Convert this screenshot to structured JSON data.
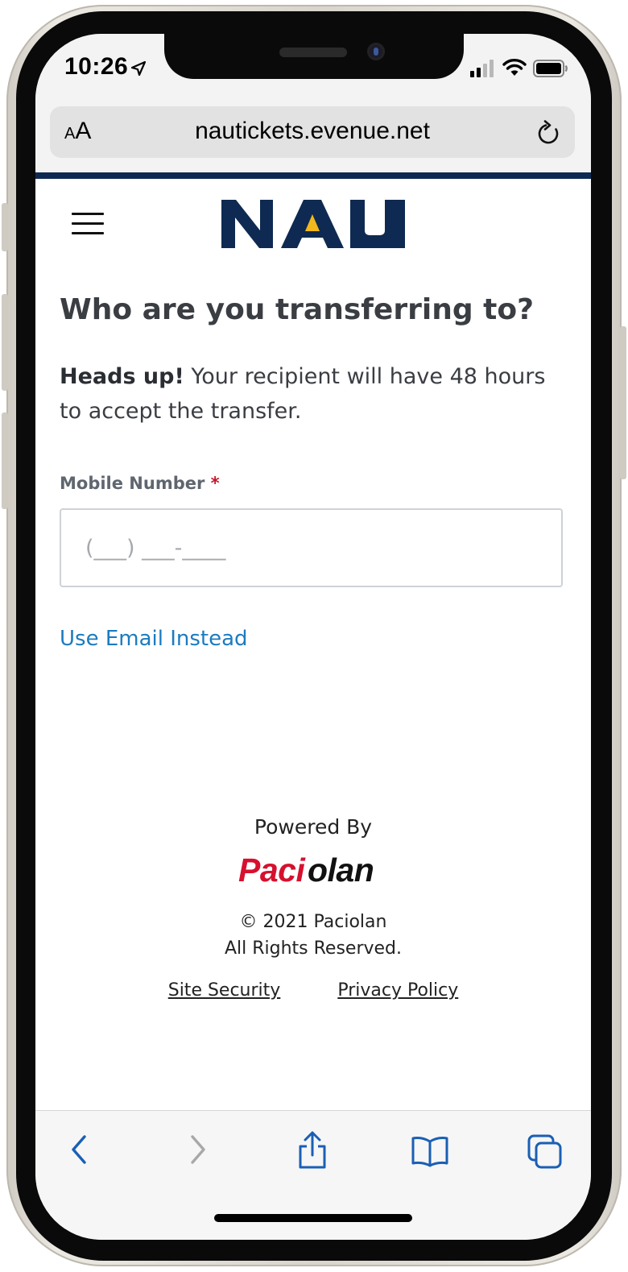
{
  "status_bar": {
    "time": "10:26",
    "location_icon": "location-arrow-icon",
    "signal_icon": "cellular-signal-icon",
    "wifi_icon": "wifi-icon",
    "battery_icon": "battery-icon"
  },
  "browser": {
    "text_size_label_small": "A",
    "text_size_label_big": "A",
    "url": "nautickets.evenue.net",
    "reload_icon": "reload-icon"
  },
  "header": {
    "menu_icon": "hamburger-menu-icon",
    "logo_text": "NAU",
    "brand_colors": {
      "navy": "#0e2a52",
      "gold": "#f2b81c"
    }
  },
  "main": {
    "title": "Who are you transferring to?",
    "notice_bold": "Heads up!",
    "notice_text": " Your recipient will have 48 hours to accept the transfer.",
    "mobile_label": "Mobile Number",
    "required_mark": "*",
    "mobile_placeholder": "(___) ___-____",
    "mobile_value": "",
    "alt_link": "Use Email Instead",
    "link_color": "#1c7bbf"
  },
  "footer": {
    "powered_by": "Powered By",
    "brand_logo_text": "Paciolan",
    "copyright": "© 2021 Paciolan",
    "rights": "All Rights Reserved.",
    "links": [
      "Site Security",
      "Privacy Policy"
    ]
  },
  "toolbar": {
    "icons": [
      "back-icon",
      "forward-icon",
      "share-icon",
      "bookmarks-icon",
      "tabs-icon"
    ],
    "accent": "#1a5fb4"
  }
}
